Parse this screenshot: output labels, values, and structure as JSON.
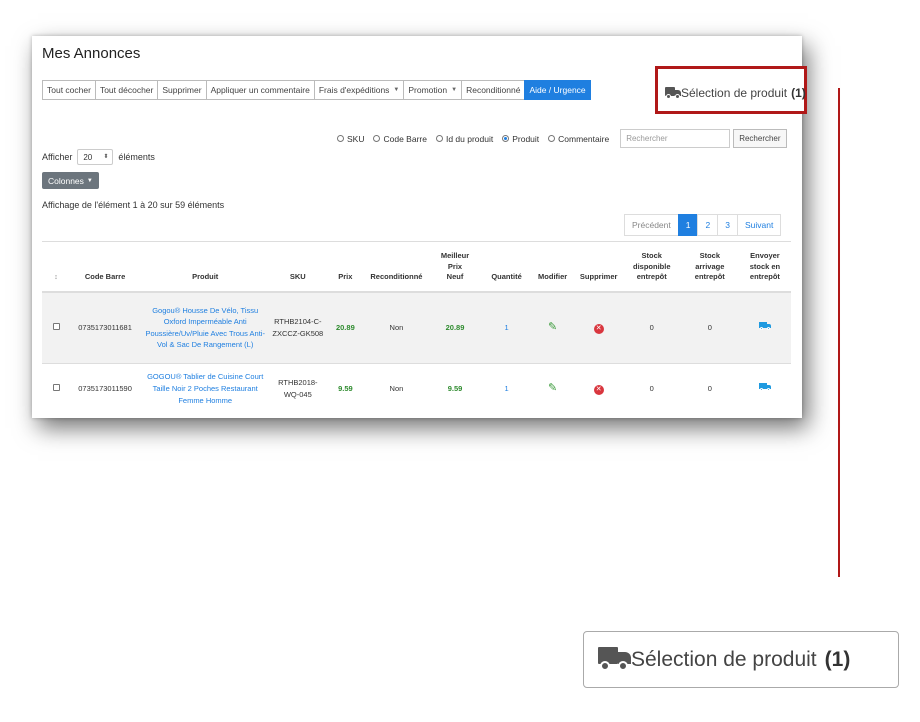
{
  "page": {
    "title": "Mes Annonces"
  },
  "toolbar": [
    {
      "label": "Tout cocher",
      "dropdown": false
    },
    {
      "label": "Tout décocher",
      "dropdown": false
    },
    {
      "label": "Supprimer",
      "dropdown": false
    },
    {
      "label": "Appliquer un commentaire",
      "dropdown": false
    },
    {
      "label": "Frais d'expéditions",
      "dropdown": true
    },
    {
      "label": "Promotion",
      "dropdown": true
    },
    {
      "label": "Reconditionné",
      "dropdown": false
    },
    {
      "label": "Aide / Urgence",
      "dropdown": false
    }
  ],
  "search": {
    "options": [
      {
        "label": "SKU",
        "selected": false
      },
      {
        "label": "Code Barre",
        "selected": false
      },
      {
        "label": "Id du produit",
        "selected": false
      },
      {
        "label": "Produit",
        "selected": true
      },
      {
        "label": "Commentaire",
        "selected": false
      }
    ],
    "placeholder": "Rechercher",
    "button_label": "Rechercher"
  },
  "page_size": {
    "prefix": "Afficher",
    "value": "20",
    "suffix": "éléments"
  },
  "columns_button": "Colonnes",
  "info_text": "Affichage de l'élément 1 à 20 sur 59 éléments",
  "pagination": {
    "previous": "Précédent",
    "pages": [
      "1",
      "2",
      "3"
    ],
    "active": "1",
    "next": "Suivant"
  },
  "table": {
    "headers": {
      "sort": "↕",
      "barcode": "Code Barre",
      "product": "Produit",
      "sku": "SKU",
      "price": "Prix",
      "refurbished": "Reconditionné",
      "best_price_l1": "Meilleur",
      "best_price_l2": "Prix",
      "best_price_l3": "Neuf",
      "quantity": "Quantité",
      "edit": "Modifier",
      "delete": "Supprimer",
      "stock_wh_l1": "Stock",
      "stock_wh_l2": "disponible",
      "stock_wh_l3": "entrepôt",
      "stock_arr_l1": "Stock",
      "stock_arr_l2": "arrivage",
      "stock_arr_l3": "entrepôt",
      "send_l1": "Envoyer",
      "send_l2": "stock en",
      "send_l3": "entrepôt"
    },
    "rows": [
      {
        "barcode": "0735173011681",
        "product": "Gogou® Housse De Vélo, Tissu Oxford Imperméable Anti Poussière/Uv/Pluie Avec Trous Anti-Vol & Sac De Rangement (L)",
        "sku": "RTHB2104-C-ZXCCZ-GK508",
        "price": "20.89",
        "refurbished": "Non",
        "best_price": "20.89",
        "quantity": "1",
        "stock_wh": "0",
        "stock_arr": "0"
      },
      {
        "barcode": "0735173011590",
        "product": "GOGOU® Tablier de Cuisine Court Taille Noir 2 Poches Restaurant Femme Homme",
        "sku": "RTHB2018-WQ-045",
        "price": "9.59",
        "refurbished": "Non",
        "best_price": "9.59",
        "quantity": "1",
        "stock_wh": "0",
        "stock_arr": "0"
      }
    ]
  },
  "selection": {
    "label": "Sélection de produit",
    "count": "(1)",
    "icon": "truck-icon"
  },
  "colors": {
    "primary": "#1f7fe0",
    "highlight": "#b01818",
    "price_green": "#2e8b2e",
    "delete_red": "#d9363e"
  }
}
